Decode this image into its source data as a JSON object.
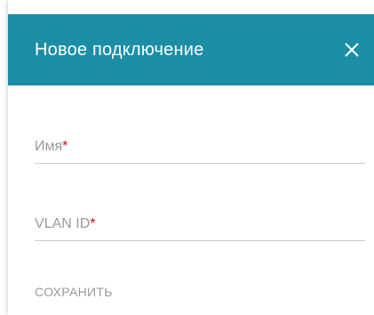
{
  "dialog": {
    "title": "Новое подключение",
    "header_color": "#1b8ea6",
    "close_icon": "close-icon"
  },
  "fields": [
    {
      "label": "Имя",
      "required_mark": "*",
      "value": ""
    },
    {
      "label": "VLAN ID",
      "required_mark": "*",
      "value": ""
    }
  ],
  "actions": {
    "save_label": "СОХРАНИТЬ"
  }
}
